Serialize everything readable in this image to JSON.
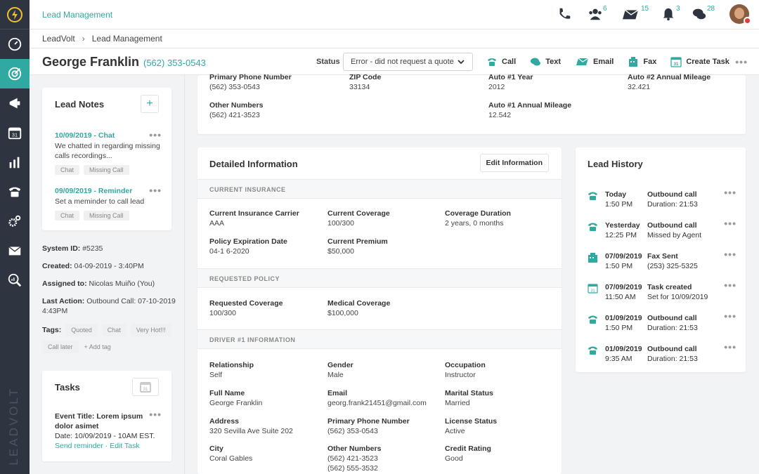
{
  "app": {
    "title": "Lead Management",
    "brand": "LEADVOLT"
  },
  "colors": {
    "accent": "#2fa9a1",
    "sidebar": "#2e3440",
    "alert": "#e23b3b"
  },
  "topbar": {
    "counts": {
      "team": "6",
      "mail": "15",
      "bell": "3",
      "chat": "28"
    }
  },
  "breadcrumb": [
    "LeadVolt",
    "Lead Management"
  ],
  "lead": {
    "name": "George Franklin",
    "phone": "(562) 353-0543"
  },
  "status": {
    "label": "Status",
    "value": "Error - did not request a quote"
  },
  "actions": {
    "call": "Call",
    "text": "Text",
    "email": "Email",
    "fax": "Fax",
    "task": "Create Task"
  },
  "notes": {
    "title": "Lead Notes",
    "items": [
      {
        "title": "10/09/2019 - Chat",
        "body": "We chatted in regarding missing calls recordings...",
        "tags": [
          "Chat",
          "Missing Call"
        ]
      },
      {
        "title": "09/09/2019 - Reminder",
        "body": "Set a meminder to call lead",
        "tags": [
          "Chat",
          "Missing Call"
        ]
      }
    ]
  },
  "system": {
    "id_label": "System ID:",
    "id": "#5235",
    "created_label": "Created:",
    "created": "04-09-2019 - 3:40PM",
    "assigned_label": "Assigned to:",
    "assigned": "Nicolas Muiño (You)",
    "last_label": "Last Action:",
    "last": "Outbound Call: 07-10-2019 4:43PM",
    "tags_label": "Tags:",
    "tags": [
      "Quoted",
      "Chat",
      "Very Hot!!!",
      "Call later"
    ],
    "add_tag": "+ Add tag"
  },
  "tasks": {
    "title": "Tasks",
    "item": {
      "title": "Event Title: Lorem ipsum dolor asimet",
      "date": "Date: 10/09/2019 - 10AM EST.",
      "send": "Send reminder",
      "dot": "·",
      "edit": "Edit Task"
    }
  },
  "topinfo": {
    "primary_label": "Primary Phone Number",
    "primary": "(562) 353-0543",
    "other_label": "Other Numbers",
    "other": "(562) 421-3523",
    "zip_label": "ZIP Code",
    "zip": "33134",
    "auto1year_label": "Auto #1 Year",
    "auto1year": "2012",
    "auto1mile_label": "Auto #1 Annual Mileage",
    "auto1mile": "12.542",
    "auto2mile_label": "Auto #2 Annual Mileage",
    "auto2mile": "32.421"
  },
  "detail": {
    "title": "Detailed Information",
    "edit": "Edit Information",
    "s1": "CURRENT INSURANCE",
    "s2": "REQUESTED POLICY",
    "s3": "DRIVER #1 INFORMATION",
    "carrier_l": "Current Insurance Carrier",
    "carrier": "AAA",
    "coverage_l": "Current Coverage",
    "coverage": "100/300",
    "duration_l": "Coverage Duration",
    "duration": "2 years, 0 months",
    "exp_l": "Policy Expiration Date",
    "exp": "04-1 6-2020",
    "premium_l": "Current Premium",
    "premium": "$50,000",
    "reqcov_l": "Requested Coverage",
    "reqcov": "100/300",
    "medcov_l": "Medical Coverage",
    "medcov": "$100,000",
    "rel_l": "Relationship",
    "rel": "Self",
    "gender_l": "Gender",
    "gender": "Male",
    "occ_l": "Occupation",
    "occ": "Instructor",
    "full_l": "Full Name",
    "full": "George Franklin",
    "email_l": "Email",
    "email": "georg.frank21451@gmail.com",
    "marital_l": "Marital Status",
    "marital": "Married",
    "addr_l": "Address",
    "addr": "320 Sevilla Ave Suite 202",
    "pphone_l": "Primary Phone Number",
    "pphone": "(562) 353-0543",
    "lic_l": "License Status",
    "lic": "Active",
    "city_l": "City",
    "city": "Coral Gables",
    "onum_l": "Other Numbers",
    "onum1": "(562) 421-3523",
    "onum2": "(562) 555-3532",
    "credit_l": "Credit Rating",
    "credit": "Good"
  },
  "history": {
    "title": "Lead History",
    "items": [
      {
        "icon": "phone-icon",
        "date": "Today",
        "time": "1:50 PM",
        "action": "Outbound call",
        "detail": "Duration: 21:53"
      },
      {
        "icon": "phone-icon",
        "date": "Yesterday",
        "time": "12:25 PM",
        "action": "Outbound call",
        "detail": "Missed by Agent"
      },
      {
        "icon": "fax-icon",
        "date": "07/09/2019",
        "time": "1:50 PM",
        "action": "Fax Sent",
        "detail": "(253) 325-5325"
      },
      {
        "icon": "calendar-icon",
        "date": "07/09/2019",
        "time": "11:50 AM",
        "action": "Task created",
        "detail": "Set for 10/09/2019"
      },
      {
        "icon": "phone-icon",
        "date": "01/09/2019",
        "time": "1:50 PM",
        "action": "Outbound call",
        "detail": "Duration: 21:53"
      },
      {
        "icon": "phone-icon",
        "date": "01/09/2019",
        "time": "9:35 AM",
        "action": "Outbound call",
        "detail": "Duration: 21:53"
      }
    ]
  }
}
